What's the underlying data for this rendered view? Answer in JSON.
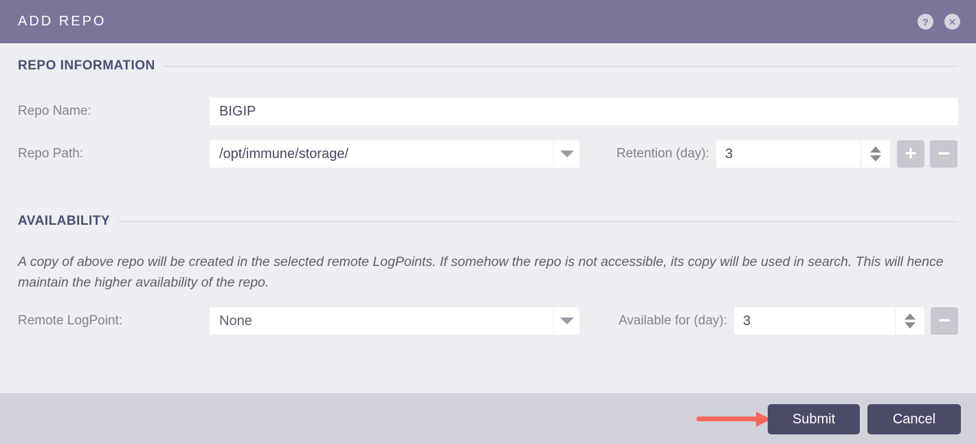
{
  "dialog": {
    "title": "ADD REPO"
  },
  "header_icons": {
    "help_glyph": "?",
    "close_glyph": "✕"
  },
  "sections": {
    "repo_information": {
      "heading": "REPO INFORMATION"
    },
    "availability": {
      "heading": "AVAILABILITY",
      "note": "A copy of above repo will be created in the selected remote LogPoints. If somehow the repo is not accessible, its copy will be used in search. This will hence maintain the higher availability of the repo."
    }
  },
  "fields": {
    "repo_name": {
      "label": "Repo Name:",
      "value": "BIGIP"
    },
    "repo_path": {
      "label": "Repo Path:",
      "value": "/opt/immune/storage/"
    },
    "retention": {
      "label": "Retention (day):",
      "value": "3"
    },
    "remote_logpoint": {
      "label": "Remote LogPoint:",
      "value": "None"
    },
    "available_for": {
      "label": "Available for (day):",
      "value": "3"
    }
  },
  "buttons": {
    "submit": "Submit",
    "cancel": "Cancel",
    "plus_glyph": "+",
    "minus_glyph": "−"
  },
  "colors": {
    "header_bg": "#7a7699",
    "body_bg": "#edeef2",
    "footer_bg": "#d2d2db",
    "heading_text": "#4d4d72",
    "label_text": "#83838f",
    "input_text": "#474761",
    "button_bg": "#4c4a69",
    "button_text": "#ffffff",
    "stepper_bg": "#c9c9d2",
    "annotation_arrow": "#f4695b"
  }
}
